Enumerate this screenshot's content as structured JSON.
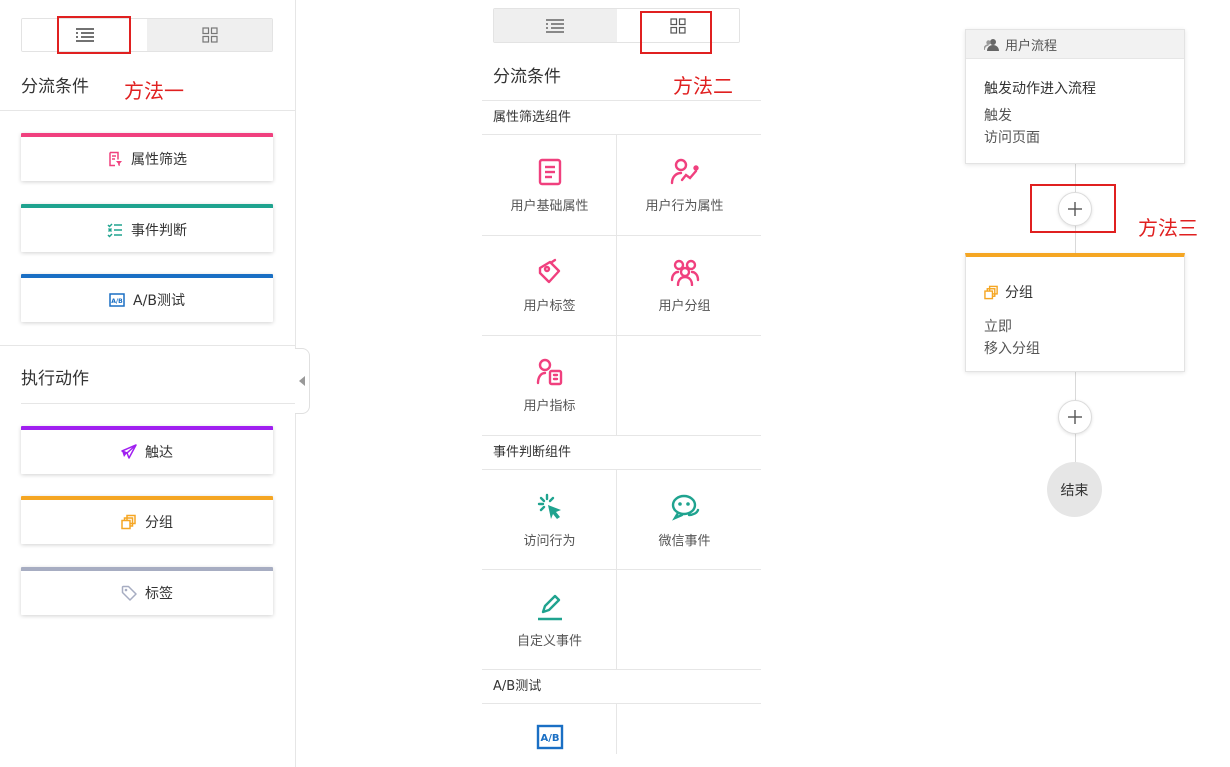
{
  "annotations": {
    "method1": "方法一",
    "method2": "方法二",
    "method3": "方法三"
  },
  "left_panel": {
    "view_toggle": {
      "list_icon": "list-icon",
      "grid_icon": "grid-icon",
      "active": "list"
    },
    "split_conditions": {
      "title": "分流条件",
      "items": [
        {
          "label": "属性筛选",
          "icon": "filter-doc-icon",
          "color": "#f0407e"
        },
        {
          "label": "事件判断",
          "icon": "checklist-icon",
          "color": "#1fa38f"
        },
        {
          "label": "A/B测试",
          "icon": "ab-test-icon",
          "color": "#1a6fc4"
        }
      ]
    },
    "actions": {
      "title": "执行动作",
      "items": [
        {
          "label": "触达",
          "icon": "paper-plane-icon",
          "color": "#a020f0"
        },
        {
          "label": "分组",
          "icon": "group-squares-icon",
          "color": "#f5a623"
        },
        {
          "label": "标签",
          "icon": "tag-icon",
          "color": "#a7adc2"
        }
      ]
    }
  },
  "mid_panel": {
    "view_toggle": {
      "active": "grid"
    },
    "title": "分流条件",
    "groups": [
      {
        "title": "属性筛选组件",
        "items": [
          {
            "label": "用户基础属性",
            "icon": "document-icon"
          },
          {
            "label": "用户行为属性",
            "icon": "user-behavior-icon"
          },
          {
            "label": "用户标签",
            "icon": "user-tag-icon"
          },
          {
            "label": "用户分组",
            "icon": "user-group-icon"
          },
          {
            "label": "用户指标",
            "icon": "user-metric-icon"
          }
        ]
      },
      {
        "title": "事件判断组件",
        "items": [
          {
            "label": "访问行为",
            "icon": "click-cursor-icon"
          },
          {
            "label": "微信事件",
            "icon": "wechat-icon"
          },
          {
            "label": "自定义事件",
            "icon": "pencil-icon"
          }
        ]
      },
      {
        "title": "A/B测试",
        "items": [
          {
            "label": "",
            "icon": "ab-test-icon"
          }
        ]
      }
    ],
    "colors": {
      "pink": "#f0407e",
      "teal": "#1fa38f",
      "blue": "#1a6fc4"
    }
  },
  "flow": {
    "start_card": {
      "header": "用户流程",
      "title": "触发动作进入流程",
      "line1": "触发",
      "line2": "访问页面"
    },
    "group_card": {
      "title": "分组",
      "line1": "立即",
      "line2": "移入分组",
      "accent": "#f5a623"
    },
    "end_label": "结束"
  }
}
